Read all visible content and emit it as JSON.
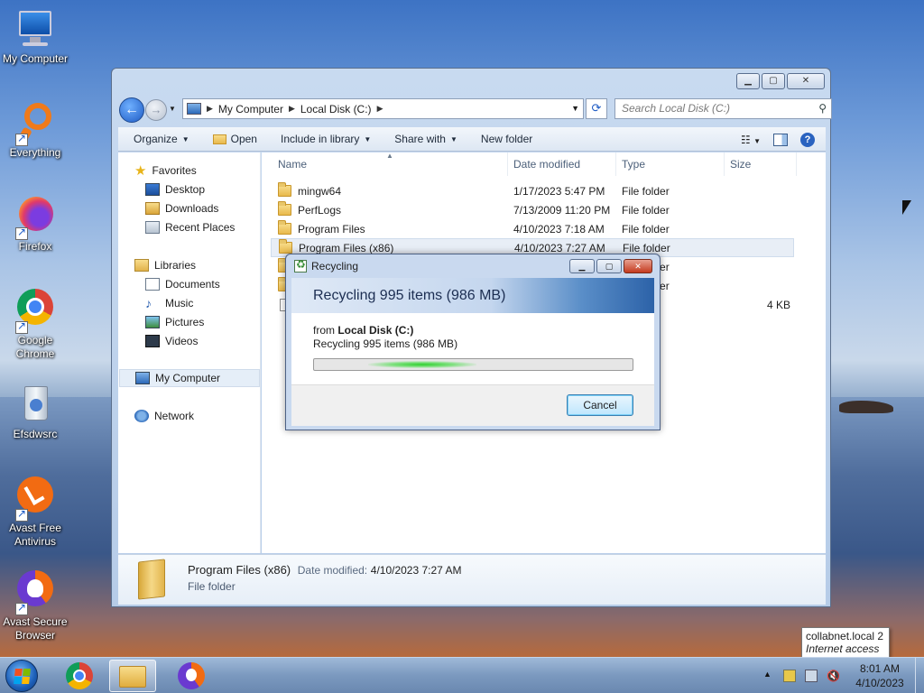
{
  "desktop": {
    "icons": [
      {
        "label": "My Computer"
      },
      {
        "label": "Everything"
      },
      {
        "label": "Firefox"
      },
      {
        "label": "Google Chrome"
      },
      {
        "label": "Efsdwsrc"
      },
      {
        "label": "Avast Free Antivirus"
      },
      {
        "label": "Avast Secure Browser"
      }
    ]
  },
  "explorer": {
    "breadcrumb": [
      "My Computer",
      "Local Disk (C:)"
    ],
    "search_placeholder": "Search Local Disk (C:)",
    "toolbar": {
      "organize": "Organize",
      "open": "Open",
      "include_in_library": "Include in library",
      "share_with": "Share with",
      "new_folder": "New folder"
    },
    "nav": {
      "favorites": "Favorites",
      "desktop": "Desktop",
      "downloads": "Downloads",
      "recent_places": "Recent Places",
      "libraries": "Libraries",
      "documents": "Documents",
      "music": "Music",
      "pictures": "Pictures",
      "videos": "Videos",
      "my_computer": "My Computer",
      "network": "Network"
    },
    "columns": {
      "name": "Name",
      "date_modified": "Date modified",
      "type": "Type",
      "size": "Size"
    },
    "files": [
      {
        "name": "mingw64",
        "date": "1/17/2023 5:47 PM",
        "type": "File folder",
        "size": ""
      },
      {
        "name": "PerfLogs",
        "date": "7/13/2009 11:20 PM",
        "type": "File folder",
        "size": ""
      },
      {
        "name": "Program Files",
        "date": "4/10/2023 7:18 AM",
        "type": "File folder",
        "size": ""
      },
      {
        "name": "Program Files (x86)",
        "date": "4/10/2023 7:27 AM",
        "type": "File folder",
        "size": ""
      },
      {
        "name": "",
        "date": "",
        "type": "File folder",
        "size": ""
      },
      {
        "name": "",
        "date": "",
        "type": "File folder",
        "size": ""
      },
      {
        "name": "",
        "date": "",
        "type": "",
        "size": "4 KB"
      }
    ],
    "details": {
      "name": "Program Files (x86)",
      "date_label": "Date modified:",
      "date_value": "4/10/2023 7:27 AM",
      "type": "File folder"
    }
  },
  "dialog": {
    "title": "Recycling",
    "heading": "Recycling 995 items (986 MB)",
    "from_label": "from",
    "from_location": "Local Disk (C:)",
    "status": "Recycling 995 items (986 MB)",
    "cancel": "Cancel"
  },
  "taskbar": {
    "time": "8:01 AM",
    "date": "4/10/2023"
  },
  "tooltip": {
    "line1": "collabnet.local  2",
    "line2": "Internet access"
  }
}
